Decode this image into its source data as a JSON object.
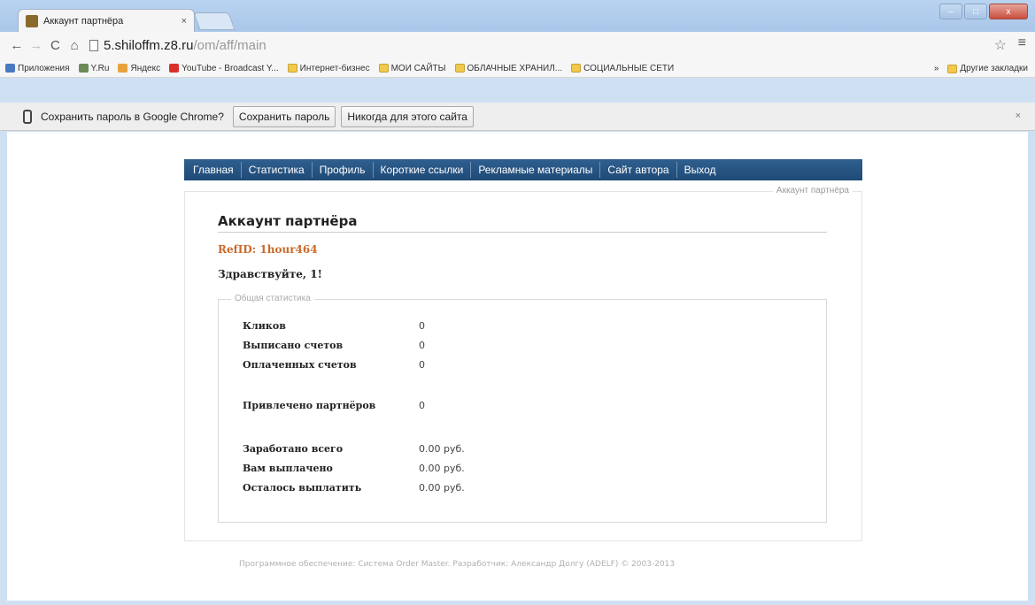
{
  "browser": {
    "tab_title": "Аккаунт партнёра",
    "tab_close": "×",
    "url_host": "5.shiloffm.z8.ru",
    "url_path": "/om/aff/main",
    "window_controls": {
      "minimize": "–",
      "maximize": "□",
      "close": "x"
    }
  },
  "bookmarks": {
    "items": [
      {
        "label": "Приложения"
      },
      {
        "label": "Y.Ru"
      },
      {
        "label": "Яндекс"
      },
      {
        "label": "YouTube - Broadcast Y..."
      },
      {
        "label": "Интернет-бизнес"
      },
      {
        "label": "МОИ САЙТЫ"
      },
      {
        "label": "ОБЛАЧНЫЕ ХРАНИЛ..."
      },
      {
        "label": "СОЦИАЛЬНЫЕ СЕТИ"
      }
    ],
    "more": "»",
    "other": "Другие закладки"
  },
  "password_bar": {
    "prompt": "Сохранить пароль в Google Chrome?",
    "save_label": "Сохранить пароль",
    "never_label": "Никогда для этого сайта",
    "close": "×"
  },
  "nav": {
    "items": [
      {
        "label": "Главная"
      },
      {
        "label": "Статистика"
      },
      {
        "label": "Профиль"
      },
      {
        "label": "Короткие ссылки"
      },
      {
        "label": "Рекламные материалы"
      },
      {
        "label": "Сайт автора"
      },
      {
        "label": "Выход"
      }
    ]
  },
  "panel": {
    "legend": "Аккаунт партнёра",
    "title": "Аккаунт партнёра",
    "refid": "RefID: 1hour464",
    "greeting": "Здравствуйте, 1!"
  },
  "stats": {
    "legend": "Общая статистика",
    "rows": [
      {
        "label": "Кликов",
        "value": "0"
      },
      {
        "label": "Выписано счетов",
        "value": "0"
      },
      {
        "label": "Оплаченных счетов",
        "value": "0"
      },
      {
        "label": "Привлечено партнёров",
        "value": "0"
      },
      {
        "label": "Заработано всего",
        "value": "0.00 руб."
      },
      {
        "label": "Вам выплачено",
        "value": "0.00 руб."
      },
      {
        "label": "Осталось выплатить",
        "value": "0.00 руб."
      }
    ]
  },
  "footer": {
    "text": "Программное обеспечение: Система Order Master. Разработчик: Александр Долгу (ADELF) © 2003-2013"
  },
  "colors": {
    "nav_bg": "#2f5f8f",
    "refid": "#c96a2b"
  }
}
